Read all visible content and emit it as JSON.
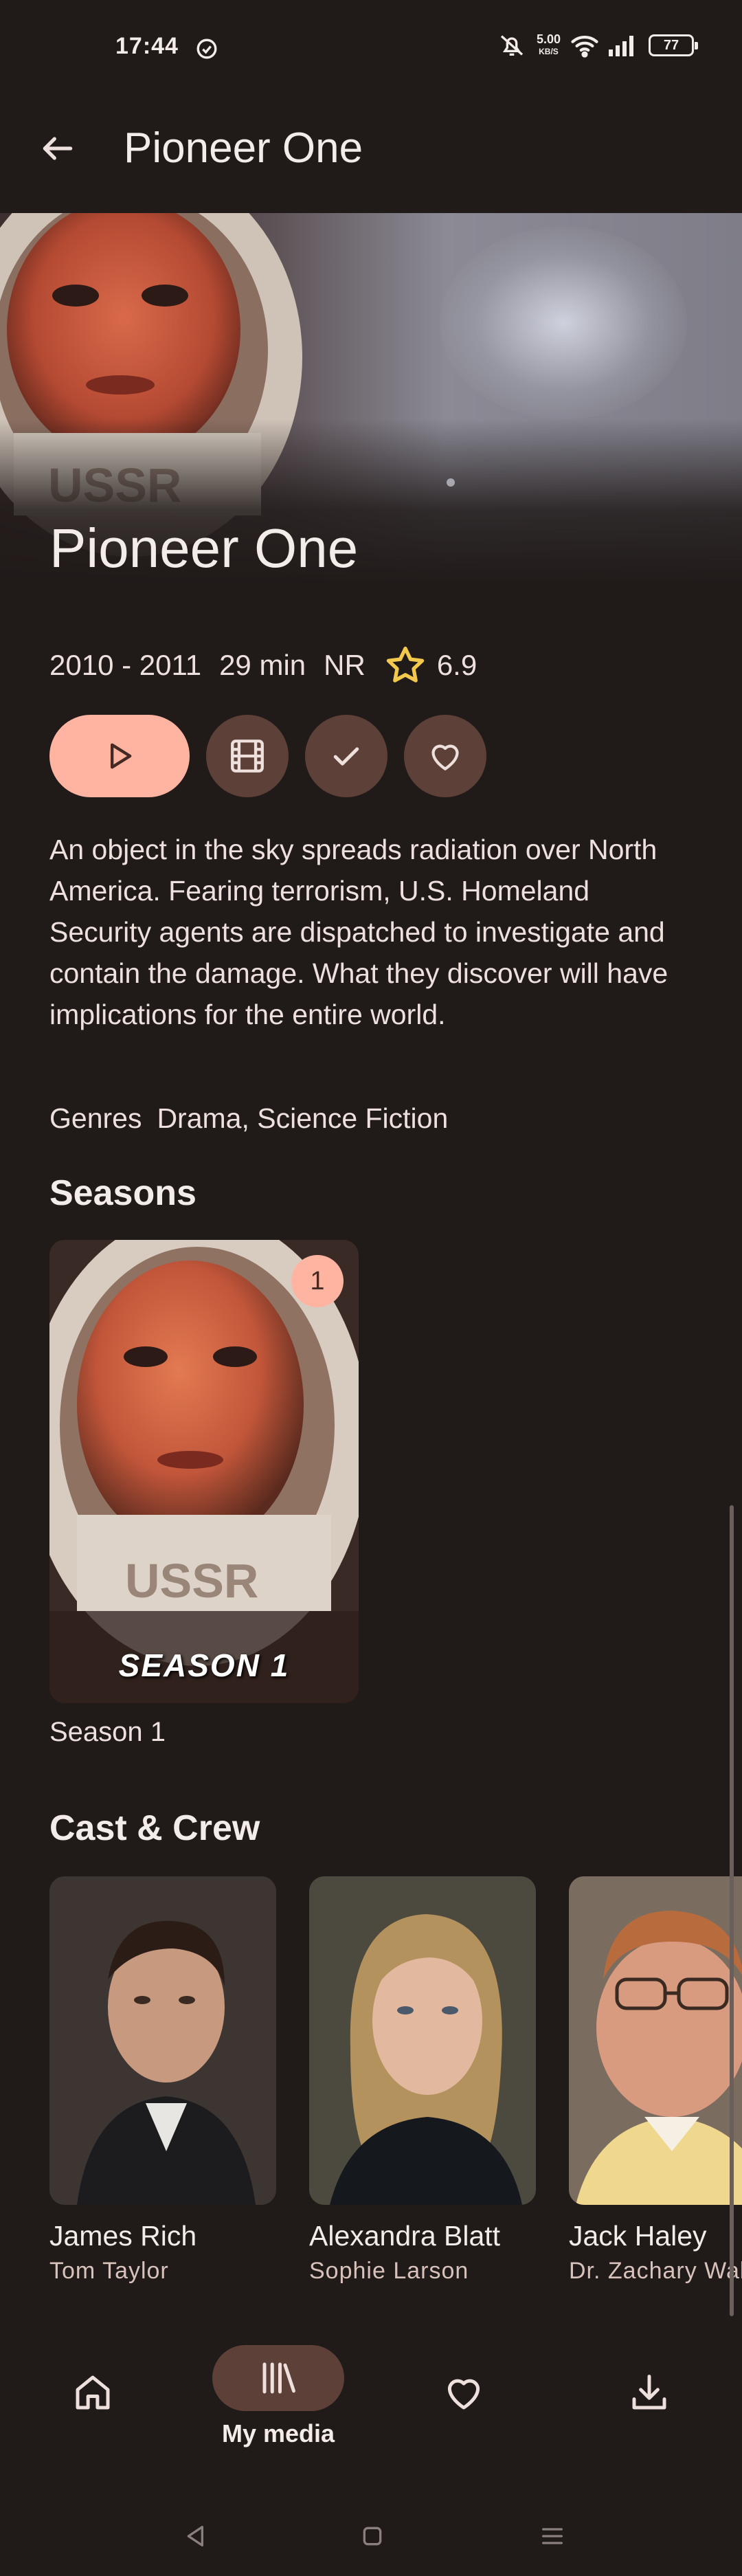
{
  "status_bar": {
    "time": "17:44",
    "net_speed": "5.00",
    "net_unit": "KB/S",
    "battery": "77"
  },
  "app_bar": {
    "title": "Pioneer One"
  },
  "show": {
    "title": "Pioneer One",
    "years": "2010 - 2011",
    "runtime": "29 min",
    "rating": "NR",
    "score": "6.9",
    "overview": "An object in the sky spreads radiation over North America. Fearing terrorism, U.S. Homeland Security agents are dispatched to investigate and contain the damage. What they discover will have implications for the entire world.",
    "genres_label": "Genres",
    "genres": "Drama, Science Fiction"
  },
  "seasons": {
    "title": "Seasons",
    "items": [
      {
        "badge": "1",
        "art_text": "SEASON 1",
        "label": "Season 1"
      }
    ]
  },
  "cast": {
    "title": "Cast & Crew",
    "items": [
      {
        "name": "James Rich",
        "role": "Tom Taylor"
      },
      {
        "name": "Alexandra Blatt",
        "role": "Sophie Larson"
      },
      {
        "name": "Jack Haley",
        "role": "Dr. Zachary Walzer"
      }
    ]
  },
  "bottom_nav": {
    "items": [
      {
        "icon": "home-icon",
        "label": ""
      },
      {
        "icon": "library-icon",
        "label": "My media"
      },
      {
        "icon": "heart-icon",
        "label": ""
      },
      {
        "icon": "download-icon",
        "label": ""
      }
    ]
  },
  "colors": {
    "background": "#201a19",
    "primary": "#ffb4a2",
    "tonal": "#5d4038",
    "star": "#f2c94c"
  }
}
